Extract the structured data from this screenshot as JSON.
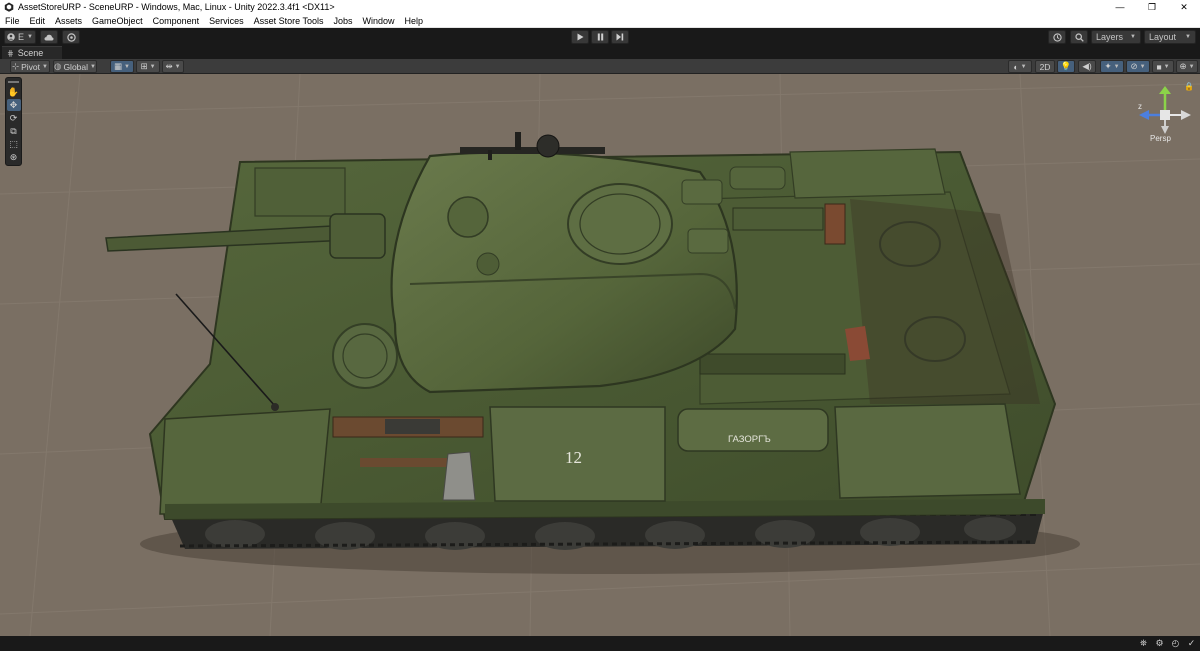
{
  "window": {
    "title": "AssetStoreURP - SceneURP - Windows, Mac, Linux - Unity 2022.3.4f1 <DX11>",
    "controls": {
      "minimize": "—",
      "restore": "❐",
      "close": "✕"
    }
  },
  "menu": [
    "File",
    "Edit",
    "Assets",
    "GameObject",
    "Component",
    "Services",
    "Asset Store Tools",
    "Jobs",
    "Window",
    "Help"
  ],
  "toolbar": {
    "account_label": "E",
    "layers_label": "Layers",
    "layout_label": "Layout",
    "icons": {
      "account": "account-icon",
      "cloud": "cloud-icon",
      "collab": "collab-icon",
      "play": "play-icon",
      "pause": "pause-icon",
      "step": "step-icon",
      "history": "history-icon",
      "search": "search-icon"
    }
  },
  "scene_tab": {
    "label": "Scene",
    "icon": "scene-icon"
  },
  "scene_toolbar": {
    "pivot_label": "Pivot",
    "global_label": "Global",
    "mode_2d_label": "2D"
  },
  "tools": [
    "hand-tool",
    "move-tool",
    "rotate-tool",
    "scale-tool",
    "rect-tool",
    "transform-tool"
  ],
  "gizmo": {
    "z_label": "z",
    "persp_label": "Persp"
  },
  "scene_text": {
    "hull_number": "12",
    "tank_label": "ГАЗОРГЪ"
  },
  "colors": {
    "ground": "#7a6f63",
    "grid_line": "#8a8075",
    "hull_green": "#4c5a35",
    "accent_blue": "#46607c"
  }
}
